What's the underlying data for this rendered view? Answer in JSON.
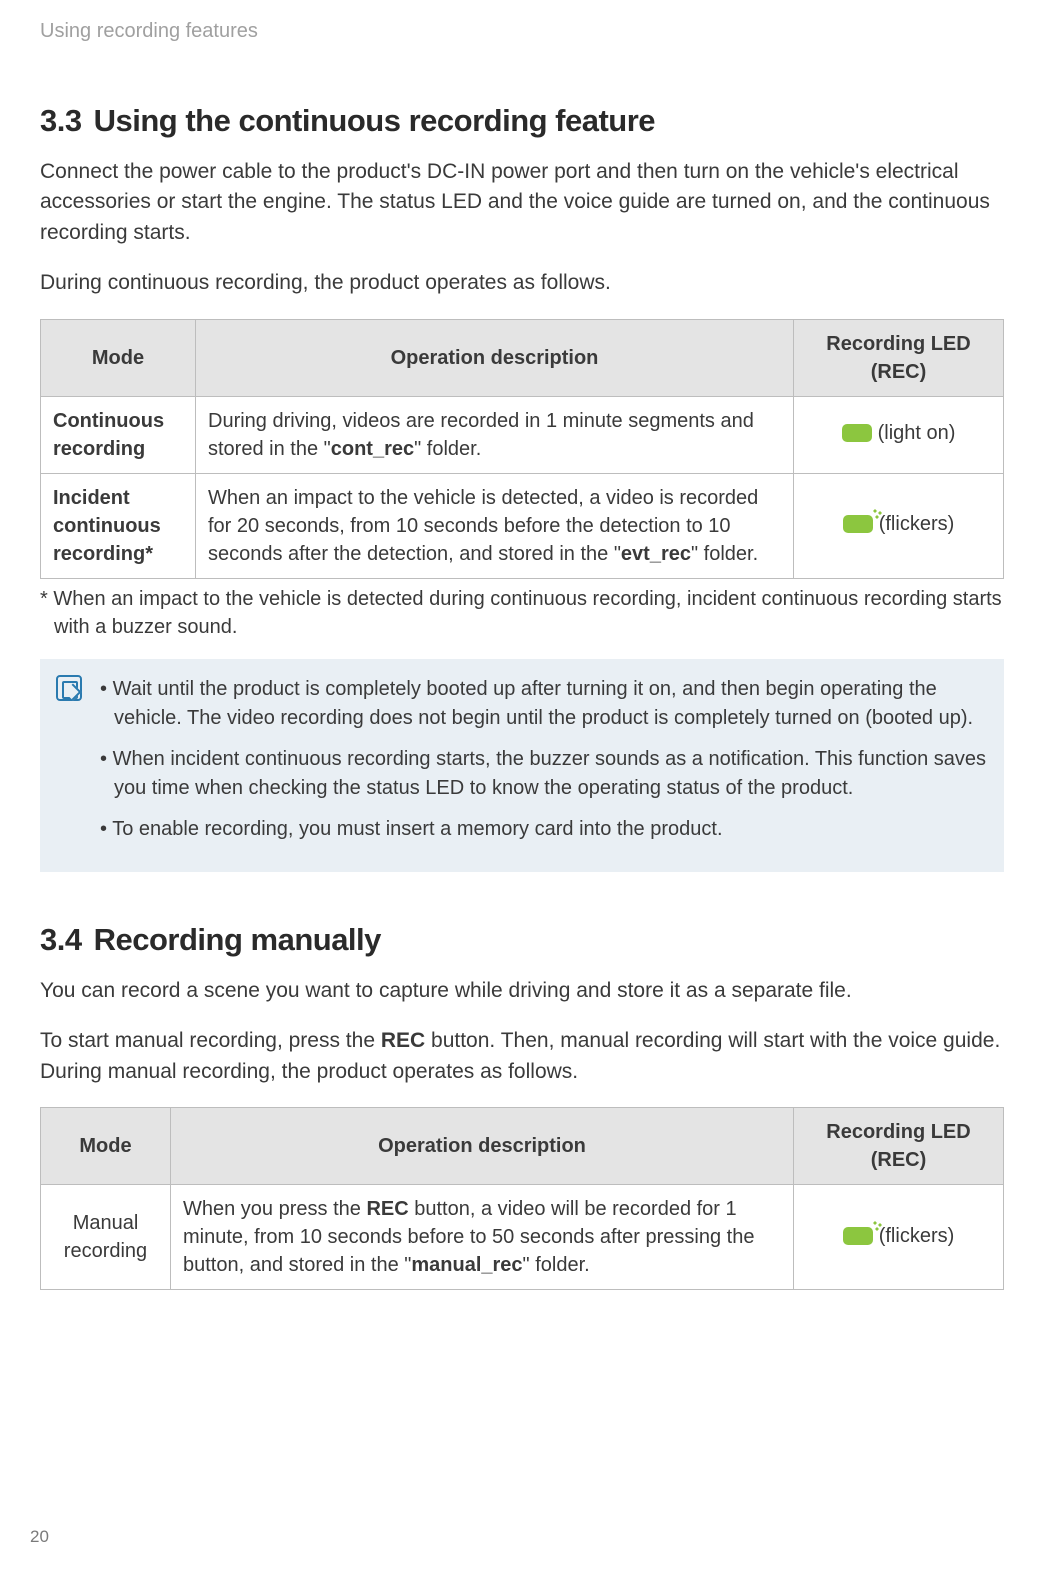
{
  "header": {
    "breadcrumb": "Using recording features"
  },
  "section33": {
    "number": "3.3",
    "title": "Using the continuous recording feature",
    "para1": "Connect the power cable to the product's DC-IN power port and then turn on the vehicle's electrical accessories or start the engine. The status LED and the voice guide are turned on, and the continuous recording starts.",
    "para2": "During continuous recording, the product operates as follows.",
    "table": {
      "headers": {
        "mode": "Mode",
        "desc": "Operation description",
        "led": "Recording LED (REC)"
      },
      "rows": [
        {
          "mode": "Continuous recording",
          "desc_pre": "During driving, videos are recorded in 1 minute segments and stored in the \"",
          "folder": "cont_rec",
          "desc_post": "\" folder.",
          "led_label": "(light on)",
          "led_state": "on"
        },
        {
          "mode": "Incident continuous recording*",
          "desc_pre": "When an impact to the vehicle is detected, a video is recorded for 20 seconds, from 10 seconds before the detection to 10 seconds after the detection, and stored in the \"",
          "folder": "evt_rec",
          "desc_post": "\" folder.",
          "led_label": "(flickers)",
          "led_state": "flicker"
        }
      ]
    },
    "footnote": "* When an impact to the vehicle is detected during continuous recording, incident continuous recording starts with a buzzer sound.",
    "notes": [
      "Wait until the product is completely booted up after turning it on, and then begin operating the vehicle. The video recording does not begin until the product is completely turned on (booted up).",
      "When incident continuous recording starts, the buzzer sounds as a notification. This function saves you time when checking the status LED to know the operating status of the product.",
      "To enable recording, you must insert a memory card into the product."
    ]
  },
  "section34": {
    "number": "3.4",
    "title": "Recording manually",
    "para1": "You can record a scene you want to capture while driving and store it as a separate file.",
    "para2_pre": "To start manual recording, press the ",
    "para2_strong": "REC",
    "para2_post": " button. Then, manual recording will start with the voice guide. During manual recording, the product operates as follows.",
    "table": {
      "headers": {
        "mode": "Mode",
        "desc": "Operation description",
        "led": "Recording LED (REC)"
      },
      "row": {
        "mode": "Manual recording",
        "desc_pre": "When you press the ",
        "desc_strong": "REC",
        "desc_mid": " button, a video will be recorded for 1 minute, from 10 seconds before to 50 seconds after pressing the button, and stored in the \"",
        "folder": "manual_rec",
        "desc_post": "\" folder.",
        "led_label": "(flickers)",
        "led_state": "flicker"
      }
    }
  },
  "page_number": "20"
}
